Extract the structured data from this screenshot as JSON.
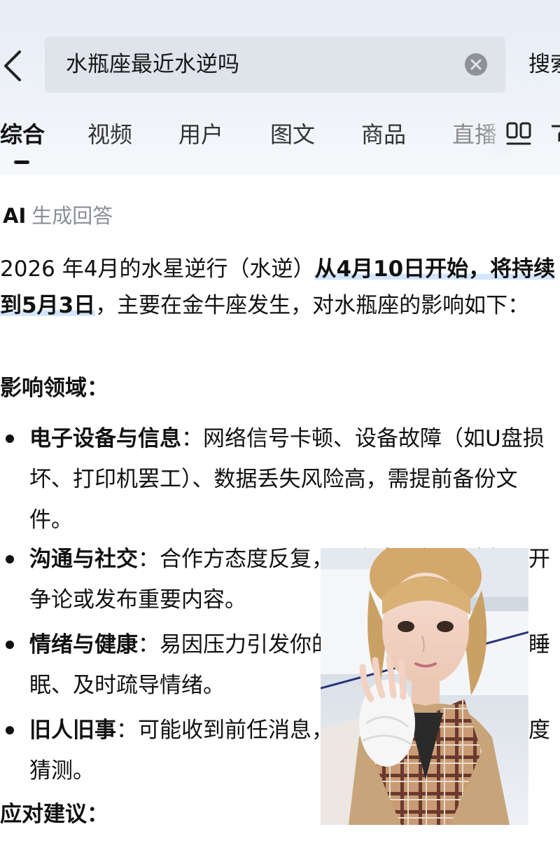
{
  "search": {
    "query": "水瓶座最近水逆吗",
    "button_label": "搜索"
  },
  "tabs": [
    {
      "label": "综合",
      "active": true
    },
    {
      "label": "视频"
    },
    {
      "label": "用户"
    },
    {
      "label": "图文"
    },
    {
      "label": "商品"
    },
    {
      "label": "直播"
    }
  ],
  "tab_icons": [
    "layout-toggle-icon",
    "filter-icon"
  ],
  "ai_answer": {
    "logo": "AI",
    "header": "生成回答",
    "intro": {
      "part1": "2026 年4月的水星逆行（水逆）",
      "highlight": "从4月10日开始，将持续到5月3日",
      "part2": "，主要在金牛座发生，对水瓶座的影响如下："
    },
    "section1_title": "影响领域：",
    "bullets": [
      {
        "title": "电子设备与信息",
        "text": "：网络信号卡顿、设备故障（如U盘损坏、打印机罢工）、数据丢失风险高，需提前备份文件。"
      },
      {
        "title": "沟通与社交",
        "text": "：合作方态度反复，易产生误解，避免公开争论或发布重要内容。"
      },
      {
        "title": "情绪与健康",
        "text": "：易因压力引发你的焦虑情绪，建议保证睡眠、及时疏导情绪。"
      },
      {
        "title": "旧人旧事",
        "text": "：可能收到前任消息，需保持冷静，避免过度猜测。"
      }
    ],
    "section2_title": "应对建议："
  },
  "overlay_photo": {
    "icon": "selfie-photo"
  },
  "colors": {
    "header_bg": "#e9eef5",
    "search_bg": "#dfe4eb",
    "highlight": "#d3e5ff",
    "muted_text": "#8a8f96"
  }
}
